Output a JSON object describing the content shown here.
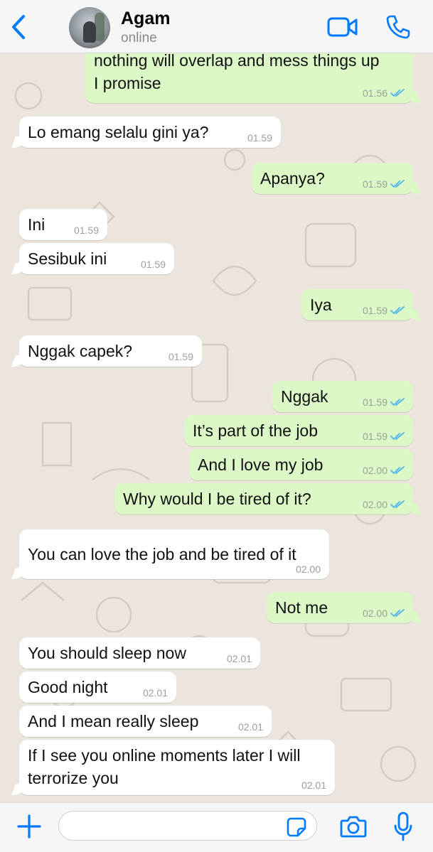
{
  "header": {
    "contact_name": "Agam",
    "status": "online",
    "icons": {
      "back": "chevron-left-icon",
      "video": "video-camera-icon",
      "call": "phone-icon"
    },
    "accent": "#007aff"
  },
  "messages": [
    {
      "side": "out",
      "lines": [
        "nothing will overlap and mess things up",
        "I promise"
      ],
      "time": "01.56",
      "read": true
    },
    {
      "side": "in",
      "text": "Lo emang selalu gini ya?",
      "time": "01.59"
    },
    {
      "side": "out",
      "text": "Apanya?",
      "time": "01.59",
      "read": true
    },
    {
      "side": "in",
      "text": "Ini",
      "time": "01.59"
    },
    {
      "side": "in",
      "text": "Sesibuk ini",
      "time": "01.59"
    },
    {
      "side": "out",
      "text": "Iya",
      "time": "01.59",
      "read": true
    },
    {
      "side": "in",
      "text": "Nggak capek?",
      "time": "01.59"
    },
    {
      "side": "out",
      "text": "Nggak",
      "time": "01.59",
      "read": true
    },
    {
      "side": "out",
      "text": "It’s part of the job",
      "time": "01.59",
      "read": true
    },
    {
      "side": "out",
      "text": "And I love my job",
      "time": "02.00",
      "read": true
    },
    {
      "side": "out",
      "text": "Why would I be tired of it?",
      "time": "02.00",
      "read": true
    },
    {
      "side": "in",
      "text": "You can love the job and be tired of it",
      "time": "02.00"
    },
    {
      "side": "out",
      "text": "Not me",
      "time": "02.00",
      "read": true
    },
    {
      "side": "in",
      "text": "You should sleep now",
      "time": "02.01"
    },
    {
      "side": "in",
      "text": "Good night",
      "time": "02.01"
    },
    {
      "side": "in",
      "text": "And I mean really sleep",
      "time": "02.01"
    },
    {
      "side": "in",
      "lines": [
        "If I see you online moments later I will",
        "terrorize you"
      ],
      "time": "02.01"
    }
  ],
  "input_bar": {
    "placeholder": "",
    "value": "",
    "icons": {
      "plus": "plus-icon",
      "sticker": "sticker-icon",
      "camera": "camera-icon",
      "mic": "microphone-icon"
    }
  },
  "colors": {
    "background": "#ece5dd",
    "incoming": "#ffffff",
    "outgoing": "#dcf8c6",
    "read_ticks": "#4fb6ec",
    "timestamp": "#9aa19a"
  }
}
